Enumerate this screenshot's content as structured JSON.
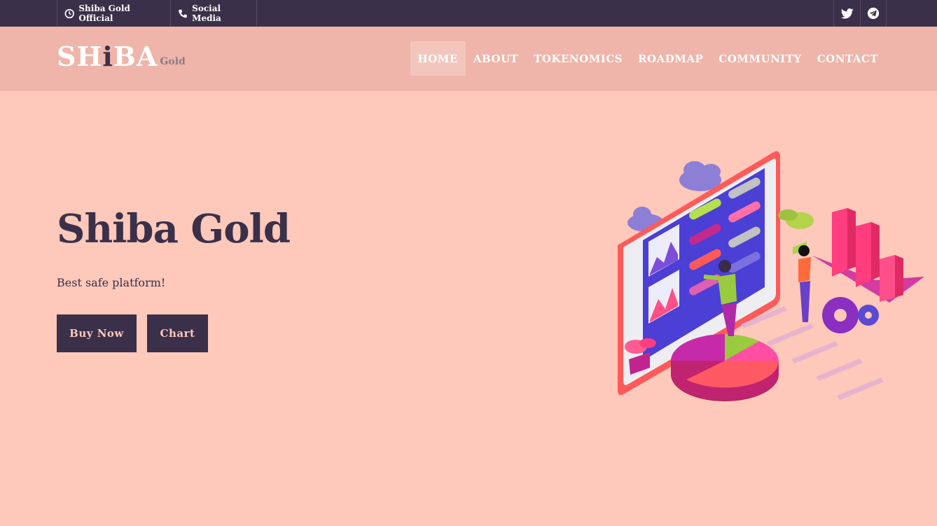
{
  "topbar": {
    "official_label": "Shiba Gold Official",
    "social_label": "Social Media",
    "clock_icon": "clock-icon",
    "phone_icon": "phone-icon",
    "social_icons": [
      "twitter-icon",
      "telegram-icon"
    ]
  },
  "header": {
    "logo_main": "SHiBA",
    "logo_sub": "Gold",
    "nav": [
      "HOME",
      "ABOUT",
      "TOKENOMICS",
      "ROADMAP",
      "COMMUNITY",
      "CONTACT"
    ],
    "active_nav": "HOME"
  },
  "hero": {
    "title": "Shiba Gold",
    "subtitle": "Best safe platform!",
    "buy_label": "Buy Now",
    "chart_label": "Chart"
  },
  "colors": {
    "background": "#fec8ba",
    "topbar": "#3b3049",
    "header": "#efb5aa",
    "dark": "#3b3049",
    "button_text": "#fec8ba"
  }
}
